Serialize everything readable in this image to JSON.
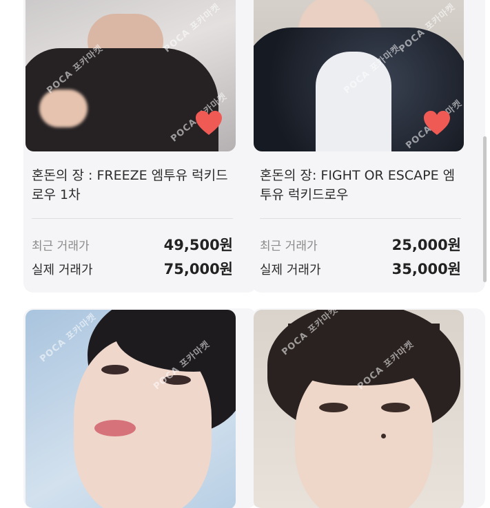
{
  "watermark": "POCA 포카마켓",
  "cards": [
    {
      "title": "혼돈의 장 : FREEZE 엠투유 럭키드로우 1차",
      "recent_label": "최근 거래가",
      "recent_price": "49,500원",
      "actual_label": "실제 거래가",
      "actual_price": "75,000원",
      "liked": true
    },
    {
      "title": "혼돈의 장: FIGHT OR ESCAPE 엠투유 럭키드로우",
      "recent_label": "최근 거래가",
      "recent_price": "25,000원",
      "actual_label": "실제 거래가",
      "actual_price": "35,000원",
      "liked": true
    }
  ],
  "colors": {
    "heart": "#f05a55",
    "card_bg": "#f5f5f7"
  }
}
